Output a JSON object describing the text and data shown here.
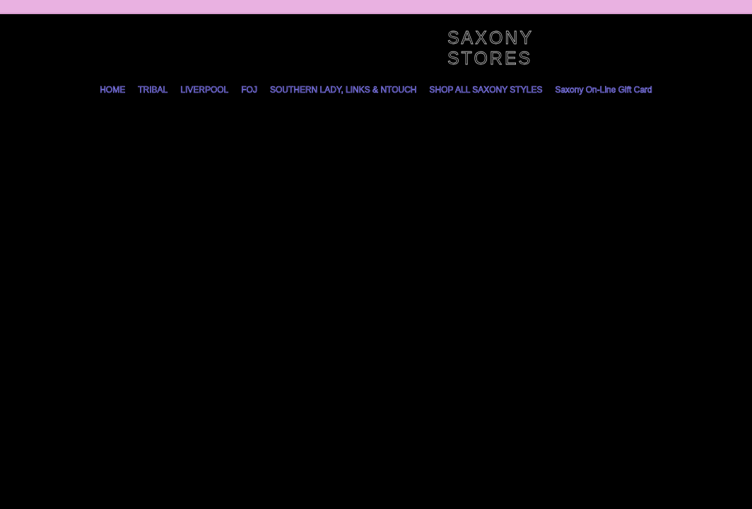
{
  "logo": {
    "lines": [
      "SAXONY",
      "STORES"
    ]
  },
  "nav": {
    "items": [
      {
        "label": "HOME"
      },
      {
        "label": "TRIBAL"
      },
      {
        "label": "LIVERPOOL"
      },
      {
        "label": "FOJ"
      },
      {
        "label": "SOUTHERN LADY, LINKS & NTOUCH"
      },
      {
        "label": "SHOP ALL SAXONY STYLES"
      },
      {
        "label": "Saxony On-Line Gift Card"
      }
    ]
  }
}
